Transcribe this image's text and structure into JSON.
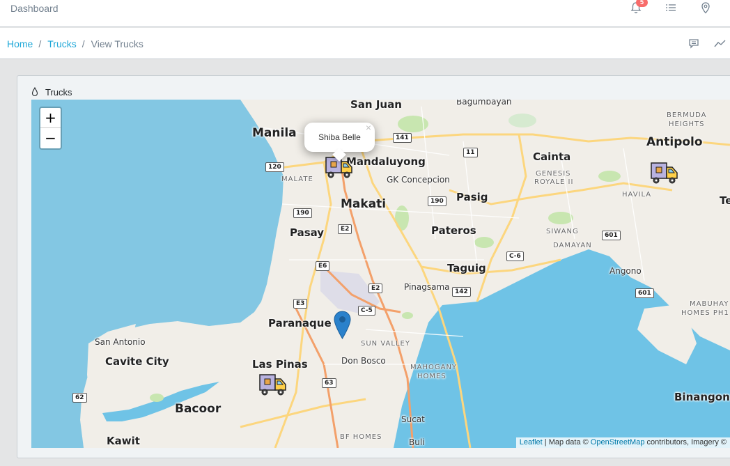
{
  "header": {
    "title": "Dashboard",
    "notification_count": "5",
    "icons": [
      "bell-icon",
      "list-icon",
      "location-pin-icon"
    ]
  },
  "breadcrumb": {
    "items": [
      "Home",
      "Trucks",
      "View Trucks"
    ],
    "separator": "/",
    "tools": [
      "comment-icon",
      "chart-line-icon"
    ]
  },
  "card": {
    "title": "Trucks",
    "icon": "droplet-icon"
  },
  "map": {
    "zoom_in": "+",
    "zoom_out": "−",
    "popup_text": "Shiba Belle",
    "popup_close": "×",
    "places": {
      "san_juan": "San Juan",
      "bagumbayan": "Bagumbayan",
      "manila": "Manila",
      "mandaluyong": "Mandaluyong",
      "malate": "MALATE",
      "gk_concepcion": "GK Concepcion",
      "makati": "Makati",
      "pasig": "Pasig",
      "cainta": "Cainta",
      "genesis": "GENESIS",
      "royale": "ROYALE II",
      "antipolo": "Antipolo",
      "bermuda": "BERMUDA",
      "heights": "HEIGHTS",
      "havila": "HAVILA",
      "te": "Te",
      "pasay": "Pasay",
      "pateros": "Pateros",
      "siwang": "SIWANG",
      "damayan": "DAMAYAN",
      "taguig": "Taguig",
      "angono": "Angono",
      "pinagsama": "Pinagsama",
      "paranaque": "Paranaque",
      "sun_valley": "SUN VALLEY",
      "mabuhay": "MABUHAY",
      "homes_ph1": "HOMES PH1",
      "san_antonio": "San Antonio",
      "cavite_city": "Cavite City",
      "las_pinas": "Las Pinas",
      "don_bosco": "Don Bosco",
      "mahogany": "MAHOGANY",
      "homes": "HOMES",
      "bacoor": "Bacoor",
      "binangonan": "Binangonan",
      "kawit": "Kawit",
      "sucat": "Sucat",
      "bf_homes": "BF HOMES",
      "buli": "Buli"
    },
    "shields": {
      "r120": "120",
      "r141": "141",
      "r11": "11",
      "r190a": "190",
      "r190b": "190",
      "e2a": "E2",
      "e6": "E6",
      "e2b": "E2",
      "c6": "C-6",
      "r601a": "601",
      "r601b": "601",
      "e3": "E3",
      "c5": "C-5",
      "r142": "142",
      "r63": "63",
      "r62": "62"
    },
    "attribution": {
      "leaflet": "Leaflet",
      "middle": " | Map data © ",
      "osm": "OpenStreetMap",
      "tail": " contributors, Imagery ©"
    }
  }
}
